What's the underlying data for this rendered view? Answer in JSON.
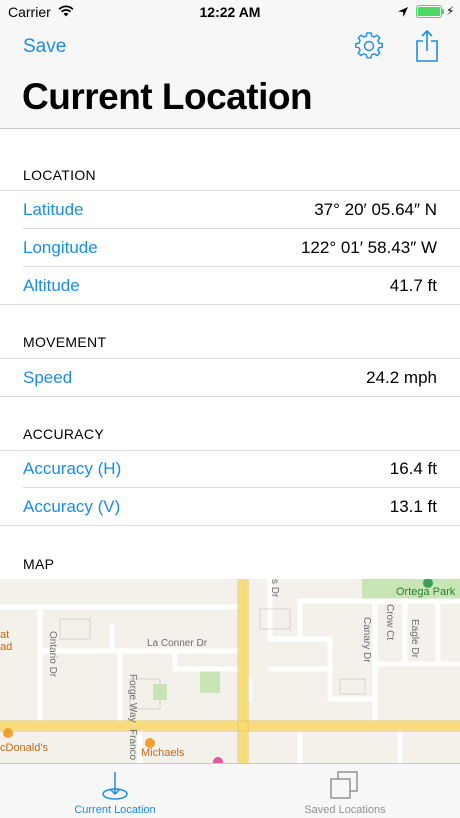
{
  "status_bar": {
    "carrier": "Carrier",
    "time": "12:22 AM"
  },
  "nav": {
    "save_label": "Save",
    "title": "Current Location",
    "settings_icon": "gear-icon",
    "share_icon": "share-icon"
  },
  "sections": {
    "location": {
      "header": "LOCATION",
      "rows": [
        {
          "label": "Latitude",
          "value": "37° 20′ 05.64″ N"
        },
        {
          "label": "Longitude",
          "value": "122° 01′ 58.43″ W"
        },
        {
          "label": "Altitude",
          "value": "41.7 ft"
        }
      ]
    },
    "movement": {
      "header": "MOVEMENT",
      "rows": [
        {
          "label": "Speed",
          "value": "24.2 mph"
        }
      ]
    },
    "accuracy": {
      "header": "ACCURACY",
      "rows": [
        {
          "label": "Accuracy (H)",
          "value": "16.4 ft"
        },
        {
          "label": "Accuracy (V)",
          "value": "13.1 ft"
        }
      ]
    },
    "map": {
      "header": "MAP"
    }
  },
  "map": {
    "labels": {
      "park": "Ortega Park",
      "la_conner": "La Conner Dr",
      "ontario": "Ontario Dr",
      "forge": "Forge Way",
      "franco": "Franco",
      "canary": "Canary Dr",
      "crow": "Crow Ct",
      "eagle": "Eagle Dr",
      "michaels": "Michaels",
      "mcdonalds": "cDonald's",
      "at": "at",
      "ad": "ad",
      "s_dr": "s Dr"
    }
  },
  "tabs": [
    {
      "label": "Current Location",
      "icon": "location-pin-icon",
      "active": true
    },
    {
      "label": "Saved Locations",
      "icon": "stacked-squares-icon",
      "active": false
    }
  ],
  "colors": {
    "accent": "#1a8ee4",
    "battery": "#4cd964",
    "park": "#c8e6b5",
    "road": "#f9dc7a"
  }
}
